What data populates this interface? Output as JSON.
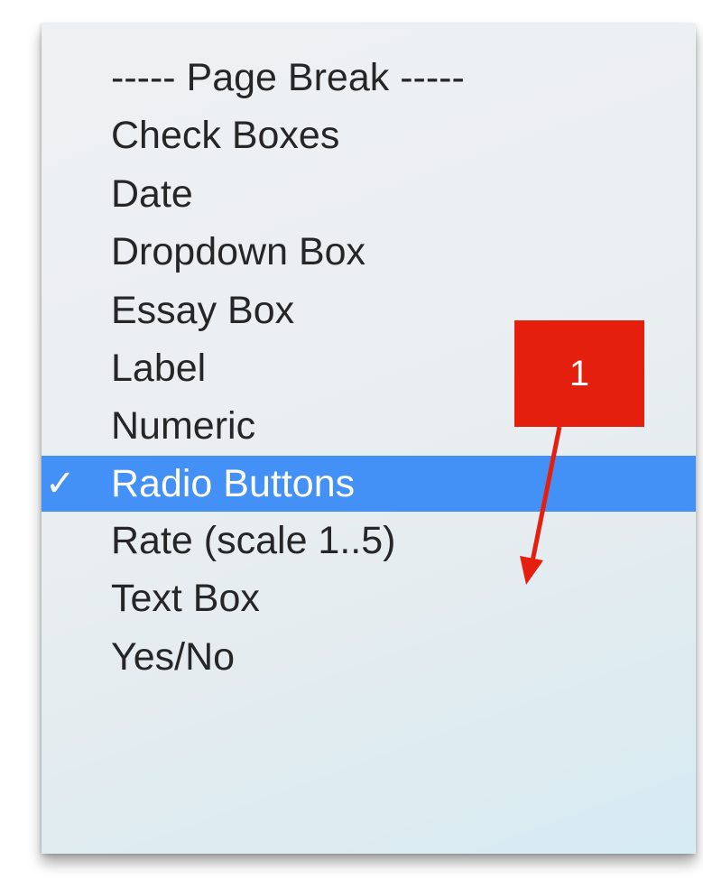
{
  "menu": {
    "items": [
      {
        "label": "----- Page Break -----",
        "selected": false
      },
      {
        "label": "Check Boxes",
        "selected": false
      },
      {
        "label": "Date",
        "selected": false
      },
      {
        "label": "Dropdown Box",
        "selected": false
      },
      {
        "label": "Essay Box",
        "selected": false
      },
      {
        "label": "Label",
        "selected": false
      },
      {
        "label": "Numeric",
        "selected": false
      },
      {
        "label": "Radio Buttons",
        "selected": true
      },
      {
        "label": "Rate (scale 1..5)",
        "selected": false
      },
      {
        "label": "Text Box",
        "selected": false
      },
      {
        "label": "Yes/No",
        "selected": false
      }
    ],
    "check_glyph": "✓"
  },
  "callout": {
    "number": "1",
    "color": "#e51f0d"
  },
  "colors": {
    "selection": "#4390f7",
    "text": "#262626"
  }
}
